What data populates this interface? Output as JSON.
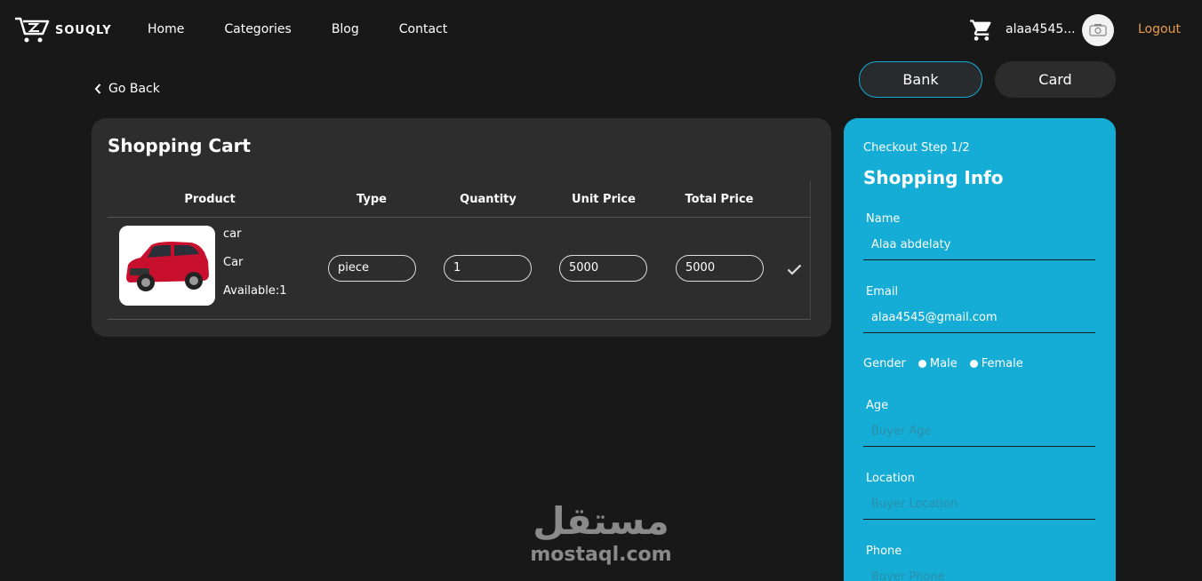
{
  "brand": {
    "name": "SOUQLY"
  },
  "nav": {
    "items": [
      "Home",
      "Categories",
      "Blog",
      "Contact"
    ]
  },
  "user": {
    "name": "alaa4545...",
    "logout": "Logout"
  },
  "go_back": "Go Back",
  "payment_tabs": {
    "bank": "Bank",
    "card": "Card"
  },
  "cart": {
    "title": "Shopping Cart",
    "headers": [
      "Product",
      "Type",
      "Quantity",
      "Unit Price",
      "Total Price"
    ],
    "rows": [
      {
        "name": "car",
        "category": "Car",
        "available": "Available:1",
        "type": "piece",
        "quantity": "1",
        "unit_price": "5000",
        "total_price": "5000"
      }
    ]
  },
  "checkout": {
    "step": "Checkout Step 1/2",
    "title": "Shopping Info",
    "name_label": "Name",
    "name_value": "Alaa abdelaty",
    "email_label": "Email",
    "email_value": "alaa4545@gmail.com",
    "gender_label": "Gender",
    "gender_male": "Male",
    "gender_female": "Female",
    "age_label": "Age",
    "age_placeholder": "Buyer Age",
    "location_label": "Location",
    "location_placeholder": "Buyer Location",
    "phone_label": "Phone",
    "phone_placeholder": "Buyer Phone"
  },
  "watermark": {
    "arabic": "مستقل",
    "latin": "mostaql.com"
  },
  "colors": {
    "accent": "#15acd6",
    "logout": "#e89a4e",
    "background": "#181818",
    "panel": "#2d2d2d"
  }
}
